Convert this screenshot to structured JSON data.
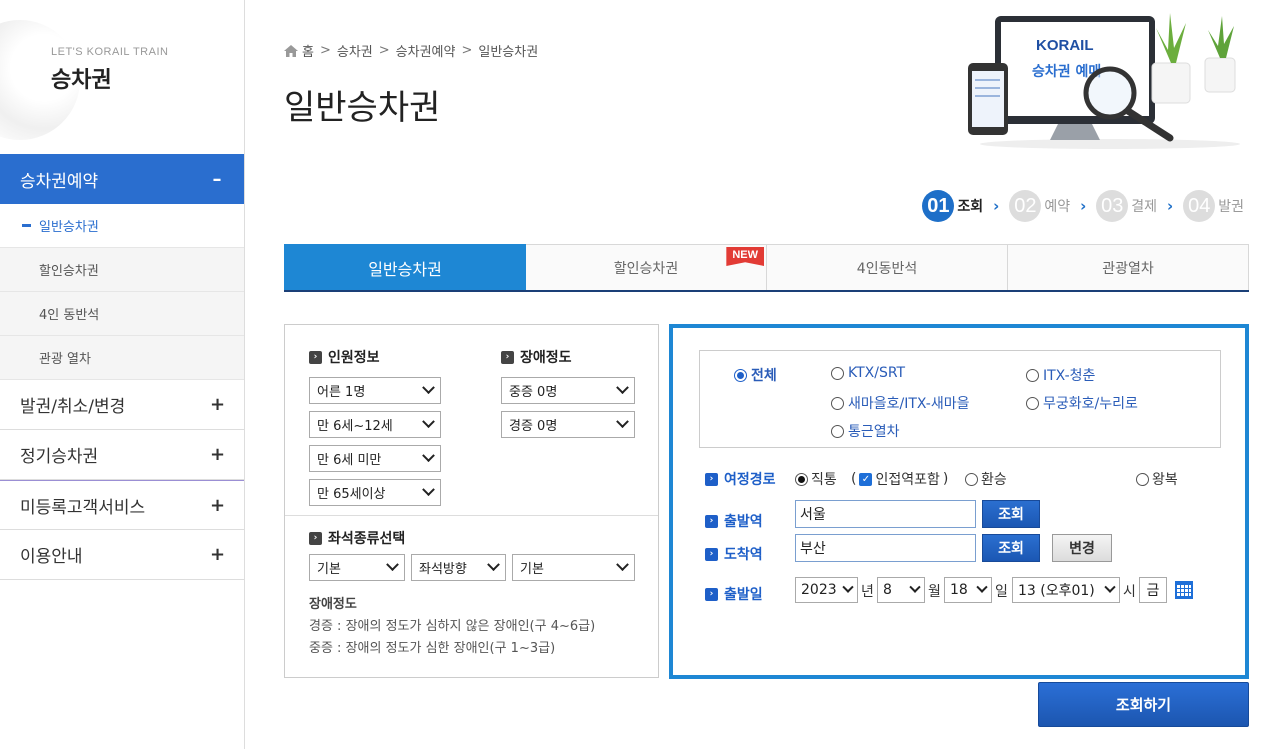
{
  "sidebar": {
    "subtitle": "LET'S KORAIL TRAIN",
    "title": "승차권",
    "menus": [
      {
        "label": "승차권예약",
        "toggle": "–"
      },
      {
        "label": "발권/취소/변경",
        "toggle": "+"
      },
      {
        "label": "정기승차권",
        "toggle": "+"
      },
      {
        "label": "미등록고객서비스",
        "toggle": "+"
      },
      {
        "label": "이용안내",
        "toggle": "+"
      }
    ],
    "submenus": [
      "일반승차권",
      "할인승차권",
      "4인 동반석",
      "관광 열차"
    ]
  },
  "breadcrumb": [
    "홈",
    "승차권",
    "승차권예약",
    "일반승차권"
  ],
  "page_title": "일반승차권",
  "illustration": {
    "brand": "KORAIL",
    "caption": "승차권 예매"
  },
  "steps": [
    {
      "num": "01",
      "label": "조회"
    },
    {
      "num": "02",
      "label": "예약"
    },
    {
      "num": "03",
      "label": "결제"
    },
    {
      "num": "04",
      "label": "발권"
    }
  ],
  "tabs": [
    "일반승차권",
    "할인승차권",
    "4인동반석",
    "관광열차"
  ],
  "new_badge": "NEW",
  "passenger": {
    "heading": "인원정보",
    "selects": [
      "어른 1명",
      "만 6세~12세",
      "만 6세 미만",
      "만 65세이상"
    ]
  },
  "disability": {
    "heading": "장애정도",
    "selects": [
      "중증 0명",
      "경증 0명"
    ]
  },
  "seat": {
    "heading": "좌석종류선택",
    "selects": [
      "기본",
      "좌석방향",
      "기본"
    ]
  },
  "notes": {
    "title": "장애정도",
    "lines": [
      "경증 : 장애의 정도가 심하지 않은 장애인(구 4~6급)",
      "중증 : 장애의 정도가 심한 장애인(구 1~3급)"
    ]
  },
  "train_types": [
    "전체",
    "KTX/SRT",
    "ITX-청춘",
    "새마을호/ITX-새마을",
    "무궁화호/누리로",
    "통근열차"
  ],
  "route": {
    "label": "여정경로",
    "options": [
      "직통",
      "인접역포함",
      "환승",
      "왕복"
    ]
  },
  "departure": {
    "label": "출발역",
    "value": "서울",
    "button": "조회"
  },
  "arrival": {
    "label": "도착역",
    "value": "부산",
    "button": "조회",
    "swap_button": "변경"
  },
  "date": {
    "label": "출발일",
    "year": "2023",
    "year_unit": "년",
    "month": "8",
    "month_unit": "월",
    "day": "18",
    "day_unit": "일",
    "hour": "13 (오후01)",
    "hour_unit": "시",
    "weekday": "금"
  },
  "search_button": "조회하기",
  "colors": {
    "accent": "#1e87d4",
    "primary": "#2a6ecf",
    "new_badge": "#e23b35"
  }
}
